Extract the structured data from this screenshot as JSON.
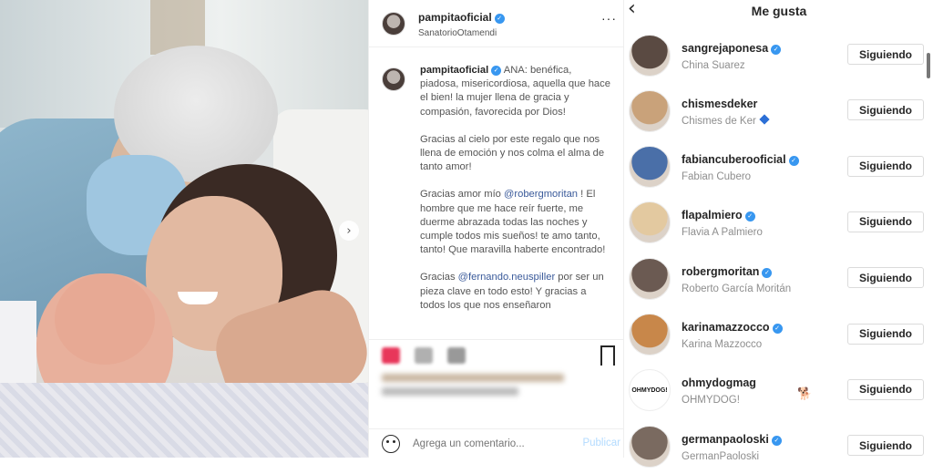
{
  "post": {
    "header_username": "pampitaoficial",
    "location": "SanatorioOtamendi",
    "more_label": "···",
    "caption_username": "pampitaoficial",
    "caption_p1": "ANA: benéfica, piadosa, misericordiosa, aquella que hace el bien! la mujer llena de gracia y compasión, favorecida por Dios!",
    "caption_p2": "Gracias al cielo por este regalo que nos llena de emoción y nos colma el alma de tanto amor!",
    "caption_p3_a": "Gracias amor mío ",
    "caption_p3_mention": "@robergmoritan",
    "caption_p3_b": " ! El hombre que me hace reír fuerte, me duerme abrazada todas las noches y cumple todos mis sueños! te amo tanto, tanto! Que maravilla haberte encontrado!",
    "caption_p4_a": "Gracias ",
    "caption_p4_mention": "@fernando.neuspiller",
    "caption_p4_b": " por ser un pieza clave en todo esto! Y gracias a todos los que nos enseñaron",
    "comment_placeholder": "Agrega un comentario...",
    "publish_label": "Publicar"
  },
  "likes": {
    "title": "Me gusta",
    "users": [
      {
        "username": "sangrejaponesa",
        "fullname": "China Suarez",
        "verified": true,
        "button": "Siguiendo",
        "avatar_color": "#5a4a42"
      },
      {
        "username": "chismesdeker",
        "fullname": "Chismes de Ker",
        "verified": false,
        "button": "Siguiendo",
        "avatar_color": "#c9a27a"
      },
      {
        "username": "fabiancuberooficial",
        "fullname": "Fabian Cubero",
        "verified": true,
        "button": "Siguiendo",
        "avatar_color": "#4a6fa8"
      },
      {
        "username": "flapalmiero",
        "fullname": "Flavia A Palmiero",
        "verified": true,
        "button": "Siguiendo",
        "avatar_color": "#e3c9a0"
      },
      {
        "username": "robergmoritan",
        "fullname": "Roberto García Moritán",
        "verified": true,
        "button": "Siguiendo",
        "avatar_color": "#6b5a52"
      },
      {
        "username": "karinamazzocco",
        "fullname": "Karina Mazzocco",
        "verified": true,
        "button": "Siguiendo",
        "avatar_color": "#c8874a"
      },
      {
        "username": "ohmydogmag",
        "fullname": "OHMYDOG!",
        "verified": false,
        "button": "Siguiendo",
        "avatar_color": "#ffffff",
        "logo_text": "OHMYDOG!"
      },
      {
        "username": "germanpaoloski",
        "fullname": "GermanPaoloski",
        "verified": true,
        "button": "Siguiendo",
        "avatar_color": "#7a6a60"
      }
    ]
  }
}
